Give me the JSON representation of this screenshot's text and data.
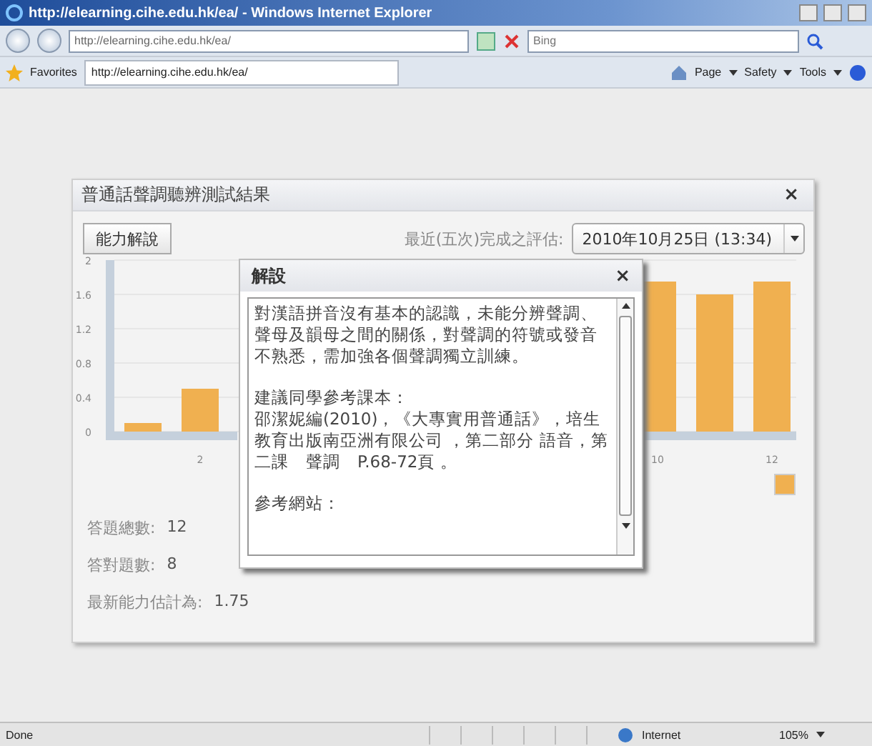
{
  "window": {
    "title": "http://elearning.cihe.edu.hk/ea/ - Windows Internet Explorer"
  },
  "address_bar": {
    "url": "http://elearning.cihe.edu.hk/ea/"
  },
  "search": {
    "placeholder": "Bing"
  },
  "favorites_bar": {
    "label": "Favorites",
    "tab": "http://elearning.cihe.edu.hk/ea/"
  },
  "command_bar": [
    "Page",
    "Safety",
    "Tools"
  ],
  "panel": {
    "title": "普通話聲調聽辨測試結果",
    "close": "×",
    "button": "能力解說",
    "assessment_label": "最近(五次)完成之評估:",
    "assessment_value": "2010年10月25日 (13:34)",
    "chart_data": {
      "type": "bar",
      "grid": true,
      "x": [
        1,
        2,
        10,
        11,
        12
      ],
      "series": [
        {
          "color": "#f0b050",
          "values": [
            0.1,
            0.5,
            1.75,
            1.6,
            1.75
          ]
        }
      ],
      "xlim": [
        0.5,
        12.4
      ],
      "ylim": [
        0,
        2
      ],
      "yticks": [
        0,
        0.4,
        0.8,
        1.2,
        1.6,
        2
      ],
      "xticks": [
        2,
        10,
        12
      ]
    },
    "stats": [
      {
        "label": "答題總數:",
        "value": "12"
      },
      {
        "label": "答對題數:",
        "value": "8"
      },
      {
        "label": "最新能力估計為:",
        "value": "1.75"
      }
    ]
  },
  "dialog": {
    "title": "解設",
    "close": "×",
    "paragraphs": [
      [
        "對漢語拼音沒有基本的認識，未能分辨聲調、聲母及韻母之間的關係，對聲調的符號或發音不熟悉，需加強各個聲調獨立訓練。"
      ],
      [
        "建議同學參考課本：",
        "邵潔妮編(2010)，《大專實用普通話》，培生教育出版南亞洲有限公司 ，第二部分 語音，第二課　聲調　P.68-72頁 。"
      ],
      [
        "參考網站："
      ]
    ]
  },
  "status_bar": {
    "text": "Done",
    "zone": "Internet",
    "zoom": "105%"
  }
}
